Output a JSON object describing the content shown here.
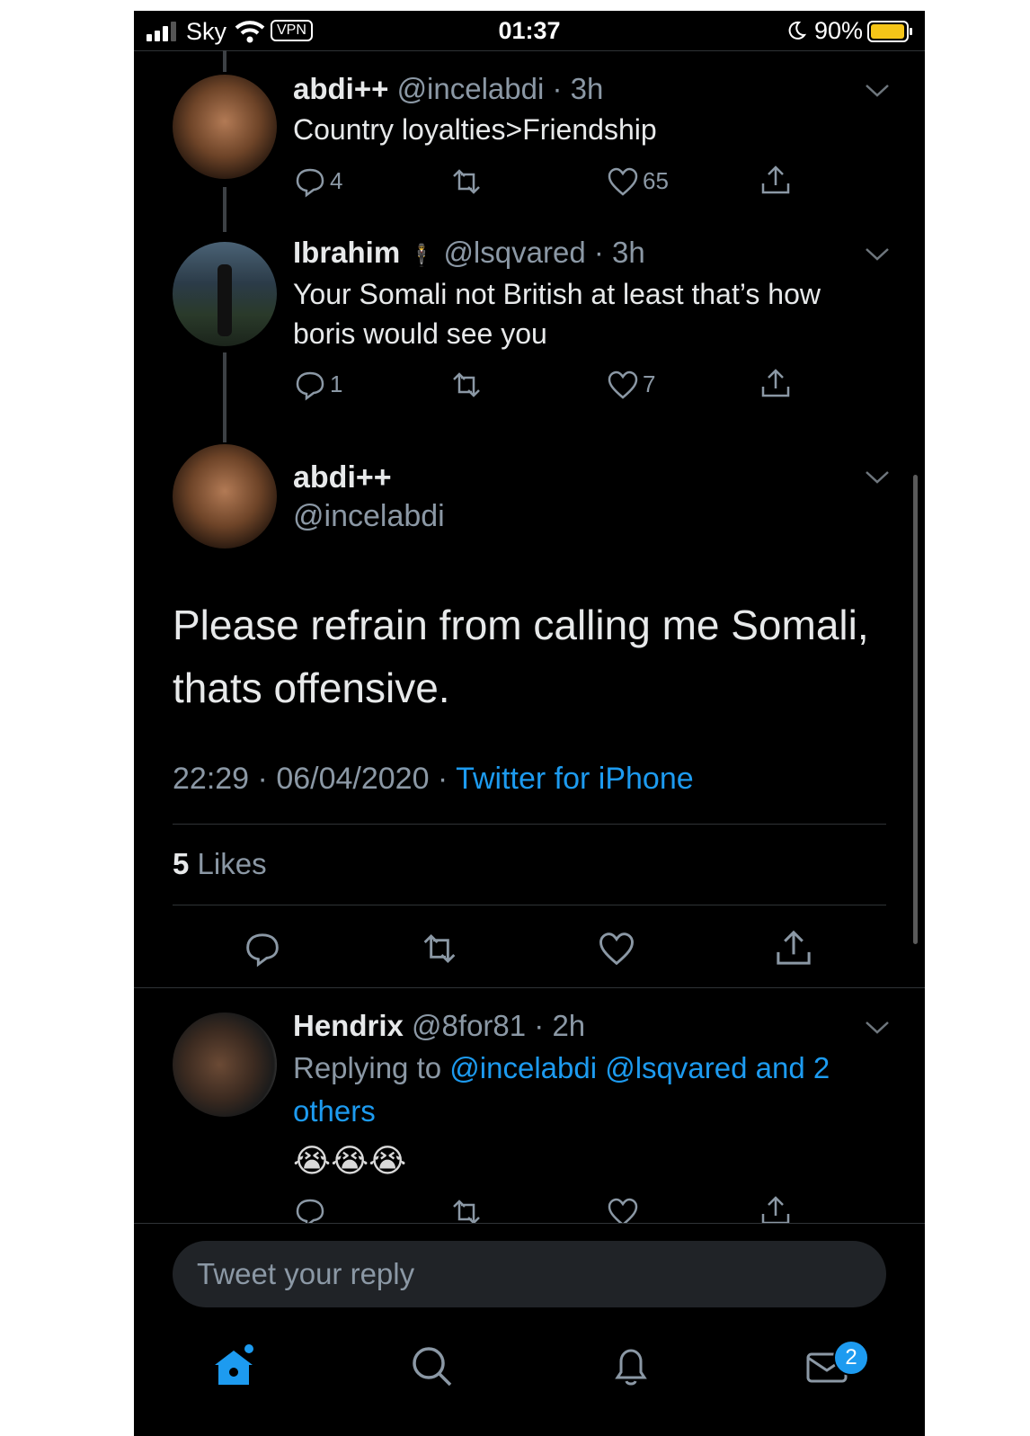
{
  "status_bar": {
    "carrier": "Sky",
    "vpn": "VPN",
    "time": "01:37",
    "battery": "90%"
  },
  "thread": [
    {
      "name": "abdi++",
      "handle": "@incelabdi",
      "time": "3h",
      "text": "Country loyalties>Friendship",
      "replies": "4",
      "retweets": "",
      "likes": "65"
    },
    {
      "name": "Ibrahim",
      "emoji": "🕴",
      "handle": "@lsqvared",
      "time": "3h",
      "text": "Your Somali not British at least that’s how boris would see you",
      "replies": "1",
      "retweets": "",
      "likes": "7"
    }
  ],
  "main_tweet": {
    "name": "abdi++",
    "handle": "@incelabdi",
    "text": "Please refrain from calling me Somali, thats offensive.",
    "time": "22:29",
    "date": "06/04/2020",
    "source": "Twitter for iPhone",
    "likes_count": "5",
    "likes_label": "Likes"
  },
  "reply": {
    "name": "Hendrix",
    "handle": "@8for81",
    "time": "2h",
    "replying_prefix": "Replying to",
    "replying_to": "@incelabdi @lsqvared and 2 others",
    "emojis": "😭😭😭"
  },
  "composer": {
    "placeholder": "Tweet your reply"
  },
  "tabbar": {
    "messages_badge": "2"
  },
  "colors": {
    "background": "#000000",
    "accent": "#1d9bf0",
    "secondary_text": "#8b98a5"
  },
  "icons": [
    "signal-icon",
    "wifi-icon",
    "moon-icon",
    "battery-icon",
    "reply-icon",
    "retweet-icon",
    "like-icon",
    "share-icon",
    "chevron-down-icon",
    "home-icon",
    "search-icon",
    "bell-icon",
    "mail-icon"
  ]
}
